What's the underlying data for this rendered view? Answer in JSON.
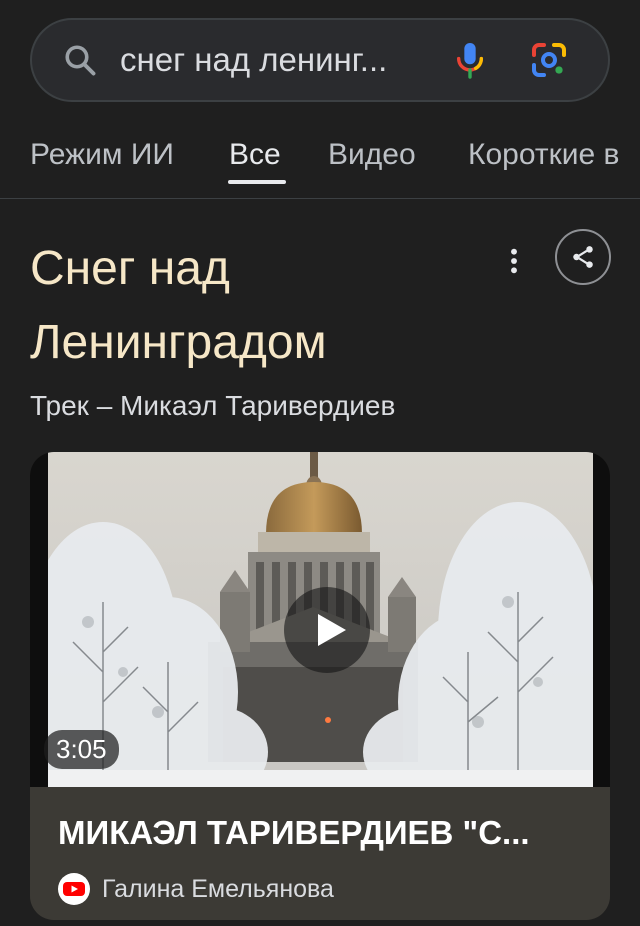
{
  "search": {
    "query": "снег над ленинг..."
  },
  "tabs": [
    {
      "label": "Режим ИИ"
    },
    {
      "label": "Все",
      "active": true
    },
    {
      "label": "Видео"
    },
    {
      "label": "Короткие в"
    }
  ],
  "result": {
    "title_line1": "Снег над",
    "title_line2": "Ленинградом",
    "subtitle": "Трек – Микаэл Таривердиев"
  },
  "video": {
    "duration": "3:05",
    "title": "МИКАЭЛ ТАРИВЕРДИЕВ \"С...",
    "channel": "Галина Емельянова"
  },
  "colors": {
    "background": "#1f1f1f",
    "title_accent": "#f6e7c7",
    "card_footer": "#3c3a35",
    "youtube_red": "#ff0000"
  }
}
